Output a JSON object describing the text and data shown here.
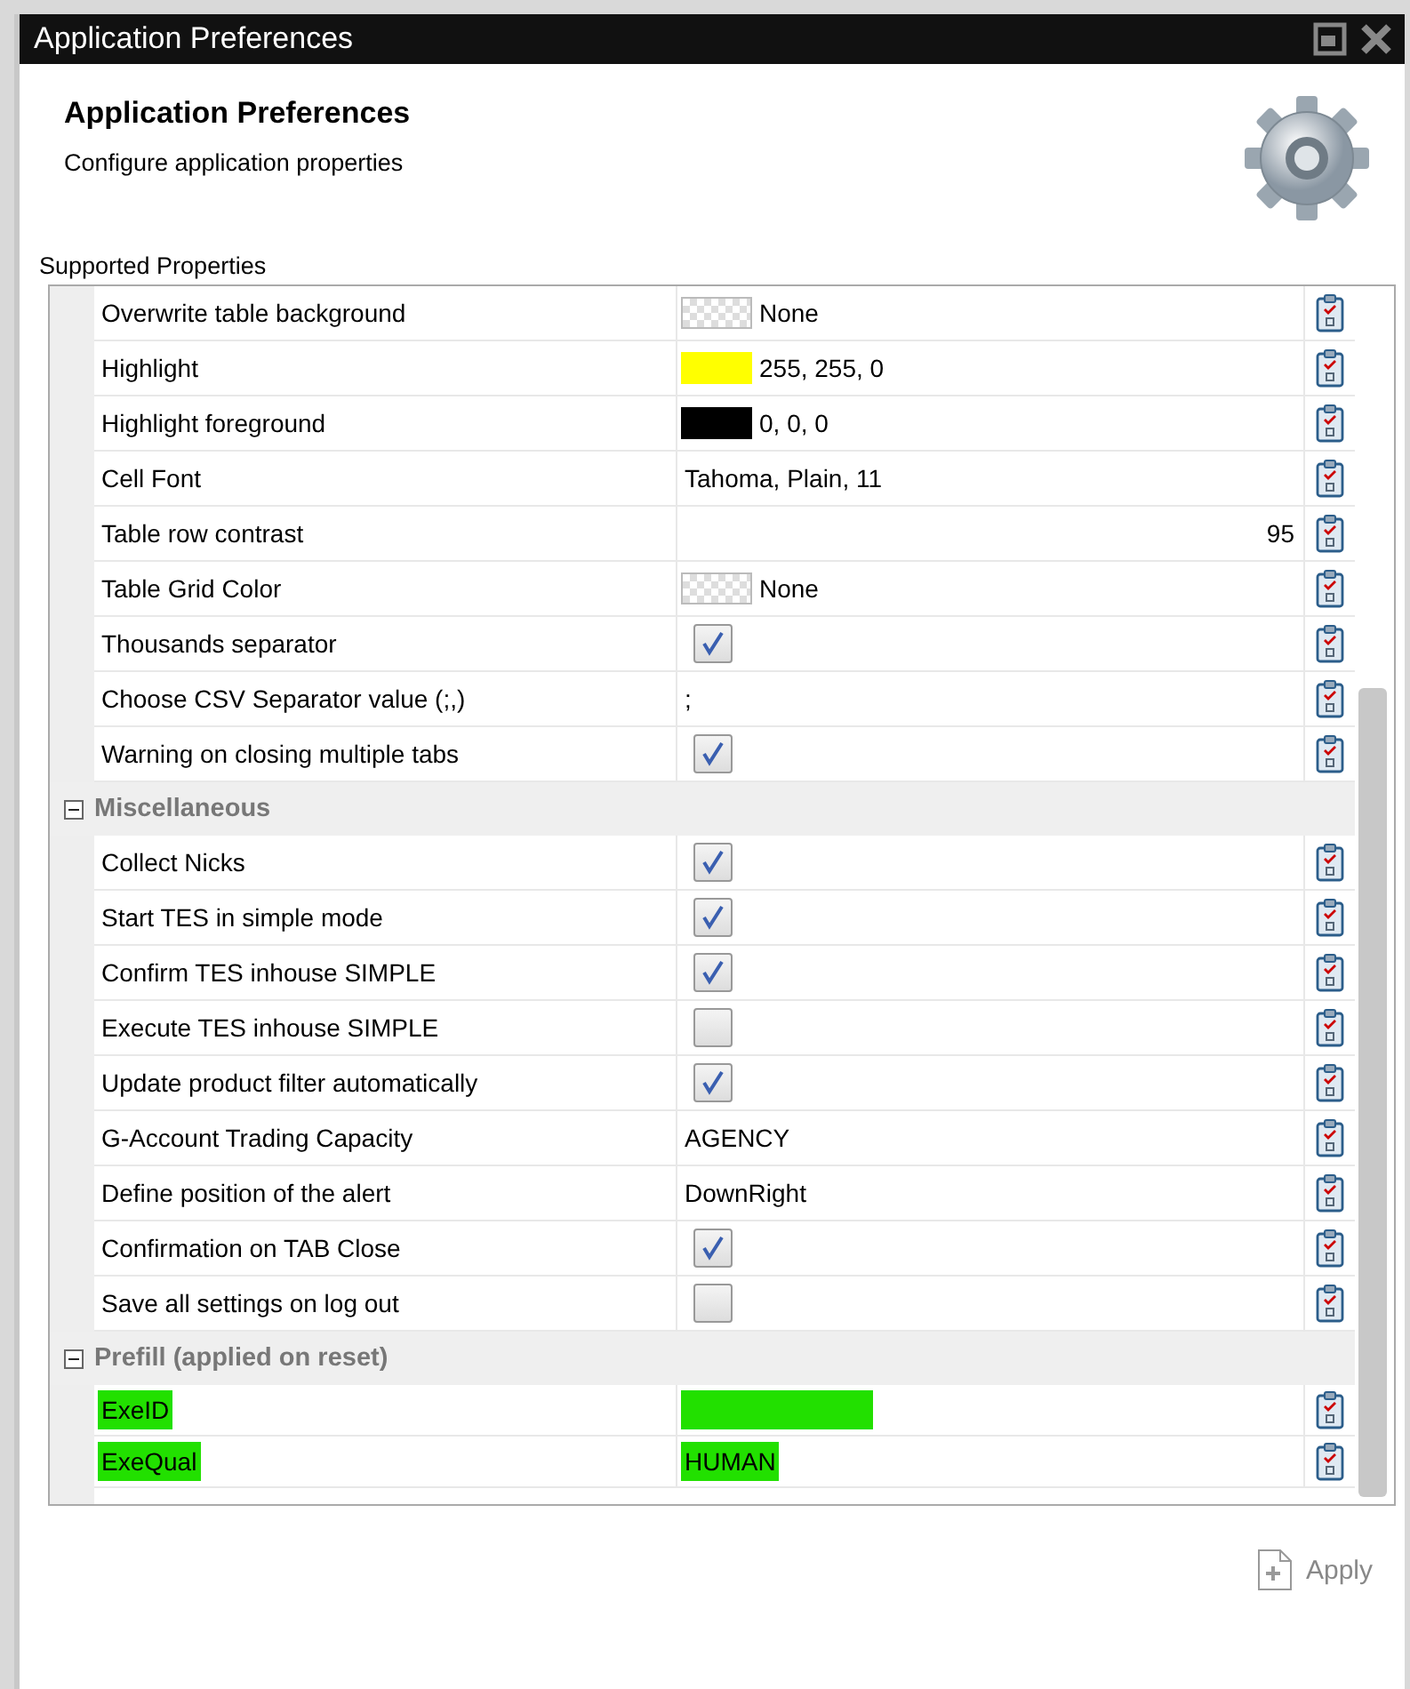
{
  "window": {
    "title": "Application Preferences"
  },
  "header": {
    "title": "Application Preferences",
    "subtitle": "Configure application properties"
  },
  "properties_label": "Supported Properties",
  "groups": [
    {
      "rows": [
        {
          "name": "Overwrite table background",
          "kind": "color",
          "value": "None",
          "highlighted": false
        },
        {
          "name": "Highlight",
          "kind": "color",
          "color": "#ffff00",
          "value": "255, 255, 0",
          "highlighted": false
        },
        {
          "name": "Highlight foreground",
          "kind": "color",
          "color": "#000000",
          "value": "0, 0, 0",
          "highlighted": false
        },
        {
          "name": "Cell Font",
          "kind": "text",
          "value": "Tahoma, Plain, 11",
          "highlighted": false
        },
        {
          "name": "Table row contrast",
          "kind": "number",
          "value": "95",
          "highlighted": false
        },
        {
          "name": "Table Grid Color",
          "kind": "color",
          "value": "None",
          "highlighted": false
        },
        {
          "name": "Thousands separator",
          "kind": "checkbox",
          "checked": true,
          "highlighted": false
        },
        {
          "name": "Choose CSV Separator value (;,)",
          "kind": "text",
          "value": ";",
          "highlighted": false
        },
        {
          "name": "Warning on closing multiple tabs",
          "kind": "checkbox",
          "checked": true,
          "highlighted": false
        }
      ]
    },
    {
      "title": "Miscellaneous",
      "expanded": true,
      "rows": [
        {
          "name": "Collect Nicks",
          "kind": "checkbox",
          "checked": true,
          "highlighted": false
        },
        {
          "name": "Start TES in simple mode",
          "kind": "checkbox",
          "checked": true,
          "highlighted": false
        },
        {
          "name": "Confirm TES inhouse SIMPLE",
          "kind": "checkbox",
          "checked": true,
          "highlighted": false
        },
        {
          "name": "Execute TES inhouse SIMPLE",
          "kind": "checkbox",
          "checked": false,
          "highlighted": false
        },
        {
          "name": "Update product filter automatically",
          "kind": "checkbox",
          "checked": true,
          "highlighted": false
        },
        {
          "name": "G-Account Trading Capacity",
          "kind": "text",
          "value": "AGENCY",
          "highlighted": false
        },
        {
          "name": "Define position of the alert",
          "kind": "text",
          "value": "DownRight",
          "highlighted": false
        },
        {
          "name": "Confirmation on TAB Close",
          "kind": "checkbox",
          "checked": true,
          "highlighted": false
        },
        {
          "name": "Save all settings on log out",
          "kind": "checkbox",
          "checked": false,
          "highlighted": false
        }
      ]
    },
    {
      "title": "Prefill (applied on reset)",
      "expanded": true,
      "rows": [
        {
          "name": "ExeID",
          "kind": "field",
          "value_filled": true,
          "highlighted": true
        },
        {
          "name": "ExeQual",
          "kind": "text",
          "value": "HUMAN",
          "highlighted": true
        }
      ]
    }
  ],
  "apply_button": {
    "label": "Apply",
    "disabled": true
  }
}
